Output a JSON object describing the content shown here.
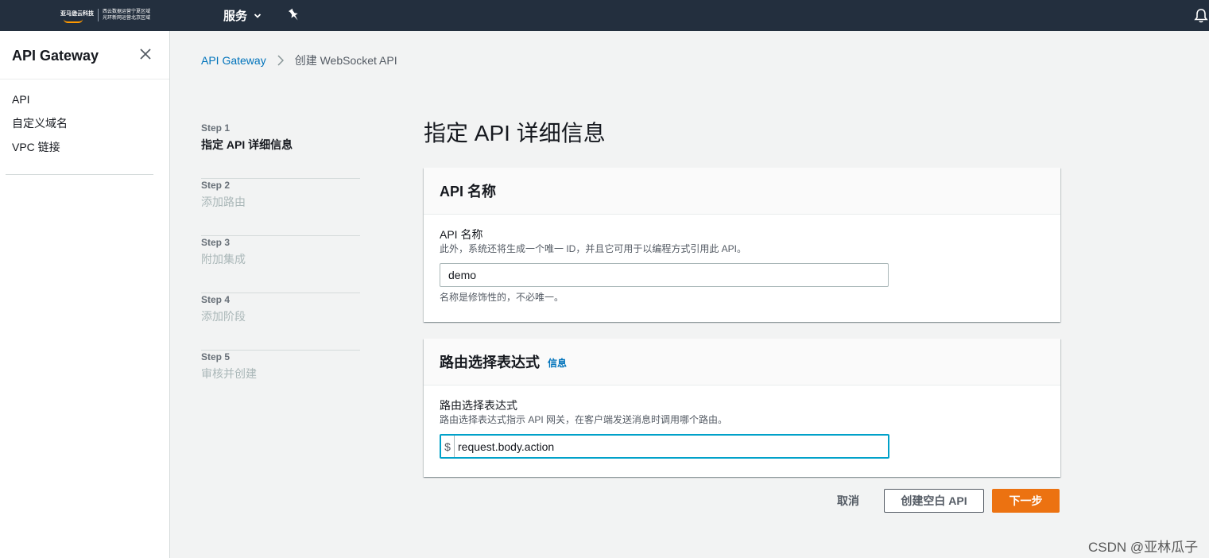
{
  "topnav": {
    "logo_brand": "亚马逊云科技",
    "logo_region_line1": "西云数据运营宁夏区域",
    "logo_region_line2": "光环新网运营北京区域",
    "services_label": "服务",
    "icons": [
      "chevron-down-icon",
      "pin-icon",
      "bell-icon"
    ]
  },
  "sidebar": {
    "title": "API Gateway",
    "items": [
      {
        "label": "API"
      },
      {
        "label": "自定义域名"
      },
      {
        "label": "VPC 链接"
      }
    ]
  },
  "breadcrumb": {
    "root": "API Gateway",
    "current": "创建 WebSocket API"
  },
  "steps": [
    {
      "num": "Step 1",
      "label": "指定 API 详细信息",
      "active": true
    },
    {
      "num": "Step 2",
      "label": "添加路由",
      "active": false
    },
    {
      "num": "Step 3",
      "label": "附加集成",
      "active": false
    },
    {
      "num": "Step 4",
      "label": "添加阶段",
      "active": false
    },
    {
      "num": "Step 5",
      "label": "审核并创建",
      "active": false
    }
  ],
  "main": {
    "title": "指定 API 详细信息",
    "api_name_panel": {
      "header": "API 名称",
      "label": "API 名称",
      "description": "此外，系统还将生成一个唯一 ID，并且它可用于以编程方式引用此 API。",
      "value": "demo",
      "constraint": "名称是修饰性的，不必唯一。"
    },
    "route_panel": {
      "header": "路由选择表达式",
      "info": "信息",
      "label": "路由选择表达式",
      "description": "路由选择表达式指示 API 网关，在客户端发送消息时调用哪个路由。",
      "prefix": "$",
      "value": "request.body.action"
    }
  },
  "actions": {
    "cancel": "取消",
    "create_blank": "创建空白 API",
    "next": "下一步"
  },
  "watermark": "CSDN @亚林瓜子",
  "colors": {
    "nav_bg": "#232f3e",
    "link": "#0073bb",
    "primary_button": "#ec7211",
    "focus_border": "#00a1c9"
  }
}
